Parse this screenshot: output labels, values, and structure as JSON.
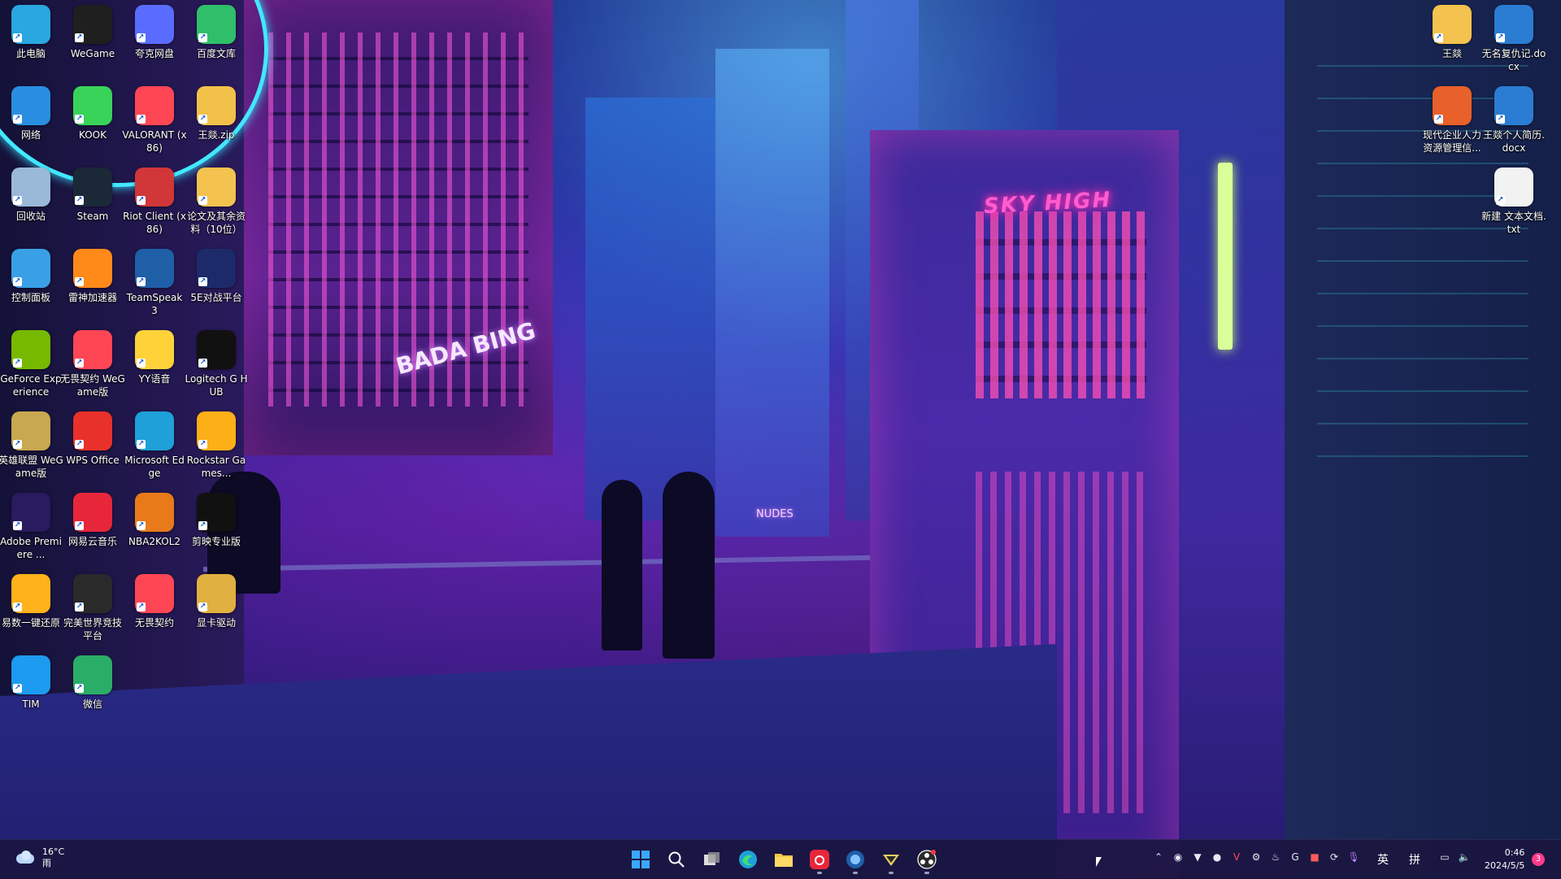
{
  "desktop": {
    "icons": [
      {
        "label": "此电脑",
        "icon": "computer-icon",
        "color": "#2aa7e0"
      },
      {
        "label": "WeGame",
        "icon": "wegame-icon",
        "color": "#1f1f1f"
      },
      {
        "label": "夸克网盘",
        "icon": "quark-cloud-icon",
        "color": "#5a6cff"
      },
      {
        "label": "百度文库",
        "icon": "baidu-wenku-icon",
        "color": "#2fbf6a"
      },
      {
        "label": "网络",
        "icon": "network-icon",
        "color": "#2a8ee0"
      },
      {
        "label": "KOOK",
        "icon": "kook-icon",
        "color": "#3ad35a"
      },
      {
        "label": "VALORANT (x86)",
        "icon": "valorant-icon",
        "color": "#ff4655"
      },
      {
        "label": "王燚.zip",
        "icon": "zip-folder-icon",
        "color": "#f2c14a"
      },
      {
        "label": "回收站",
        "icon": "recycle-bin-icon",
        "color": "#9ab8d8"
      },
      {
        "label": "Steam",
        "icon": "steam-icon",
        "color": "#1b2838"
      },
      {
        "label": "Riot Client (x86)",
        "icon": "riot-client-icon",
        "color": "#d13639"
      },
      {
        "label": "论文及其余资料（10位）",
        "icon": "folder-icon",
        "color": "#f4c24e"
      },
      {
        "label": "控制面板",
        "icon": "control-panel-icon",
        "color": "#3aa0e6"
      },
      {
        "label": "雷神加速器",
        "icon": "leishen-accelerator-icon",
        "color": "#ff8a1a"
      },
      {
        "label": "TeamSpeak 3",
        "icon": "teamspeak-icon",
        "color": "#1e5fa8"
      },
      {
        "label": "5E对战平台",
        "icon": "5e-platform-icon",
        "color": "#1d2a6a"
      },
      {
        "label": "GeForce Experience",
        "icon": "geforce-icon",
        "color": "#76b900"
      },
      {
        "label": "无畏契约 WeGame版",
        "icon": "valorant-wegame-icon",
        "color": "#ff4655"
      },
      {
        "label": "YY语音",
        "icon": "yy-voice-icon",
        "color": "#ffd23a"
      },
      {
        "label": "Logitech G HUB",
        "icon": "logitech-ghub-icon",
        "color": "#111111"
      },
      {
        "label": "英雄联盟 WeGame版",
        "icon": "lol-wegame-icon",
        "color": "#c8a850"
      },
      {
        "label": "WPS Office",
        "icon": "wps-office-icon",
        "color": "#e8312a"
      },
      {
        "label": "Microsoft Edge",
        "icon": "edge-icon",
        "color": "#1fa0d8"
      },
      {
        "label": "Rockstar Games...",
        "icon": "rockstar-icon",
        "color": "#fcaf17"
      },
      {
        "label": "Adobe Premiere ...",
        "icon": "premiere-icon",
        "color": "#2a1a5e"
      },
      {
        "label": "网易云音乐",
        "icon": "netease-music-icon",
        "color": "#e8263a"
      },
      {
        "label": "NBA2KOL2",
        "icon": "nba2kol2-icon",
        "color": "#e87a1a"
      },
      {
        "label": "剪映专业版",
        "icon": "capcut-icon",
        "color": "#111111"
      },
      {
        "label": "易数一键还原",
        "icon": "restore-icon",
        "color": "#ffb21a"
      },
      {
        "label": "完美世界竞技平台",
        "icon": "perfect-world-icon",
        "color": "#2a2a2a"
      },
      {
        "label": "无畏契约",
        "icon": "valorant-cn-icon",
        "color": "#ff4655"
      },
      {
        "label": "显卡驱动",
        "icon": "gpu-driver-icon",
        "color": "#e0b040"
      },
      {
        "label": "TIM",
        "icon": "tim-icon",
        "color": "#1d9bf0"
      },
      {
        "label": "微信",
        "icon": "wechat-icon",
        "color": "#2aae67"
      }
    ],
    "right_icons": [
      {
        "label": "王燚",
        "icon": "folder-icon",
        "color": "#f4c24e"
      },
      {
        "label": "无名复仇记.docx",
        "icon": "word-doc-icon",
        "color": "#2b7cd3"
      },
      {
        "label": "现代企业人力资源管理信...",
        "icon": "ppt-icon",
        "color": "#e8602a"
      },
      {
        "label": "王燚个人简历.docx",
        "icon": "word-doc-icon",
        "color": "#2b7cd3"
      },
      {
        "label": "新建 文本文档.txt",
        "icon": "text-file-icon",
        "color": "#f2f2f2"
      }
    ]
  },
  "wallpaper": {
    "sign_sky_high": "SKY HIGH",
    "sign_bada_bing": "BADA BING",
    "sign_nudes": "NUDES"
  },
  "taskbar": {
    "weather": {
      "temp": "16°C",
      "condition": "雨"
    },
    "ime_lang": "英",
    "ime_mode": "拼",
    "time": "0:46",
    "date": "2024/5/5",
    "notification_count": "3"
  }
}
